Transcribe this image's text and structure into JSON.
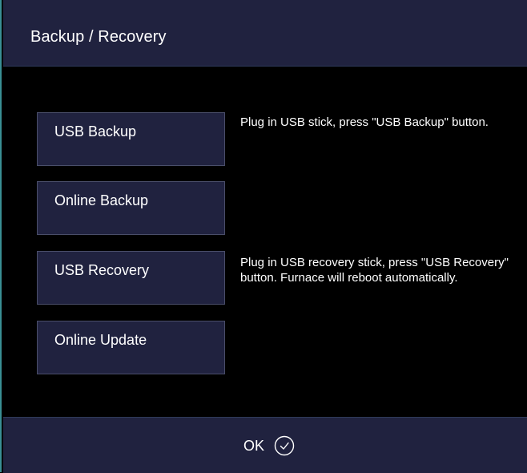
{
  "dialog": {
    "title": "Backup / Recovery"
  },
  "buttons": {
    "usb_backup": "USB Backup",
    "online_backup": "Online Backup",
    "usb_recovery": "USB Recovery",
    "online_update": "Online Update"
  },
  "descriptions": {
    "usb_backup": "Plug in USB stick, press \"USB Backup\" button.",
    "usb_recovery": "Plug in USB recovery stick, press \"USB Recovery\" button. Furnace will reboot automatically."
  },
  "footer": {
    "ok_label": "OK",
    "ok_icon": "check-circle-icon"
  },
  "colors": {
    "panel": "#20223f",
    "background": "#000000",
    "text": "#ffffff",
    "accent_border": "#3a8f94"
  }
}
